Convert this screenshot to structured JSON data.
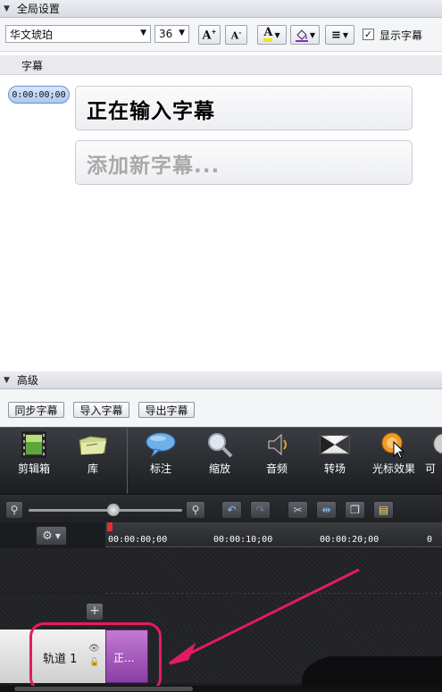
{
  "global_settings": {
    "title": "全局设置"
  },
  "toolbar": {
    "font": "华文琥珀",
    "size": "36",
    "show_captions": "显示字幕",
    "show_captions_checked": true
  },
  "captions_list": {
    "header": "字幕",
    "items": [
      {
        "time": "0:00:00;00",
        "text": "正在输入字幕"
      }
    ],
    "add_placeholder": "添加新字幕..."
  },
  "advanced": {
    "title": "高级",
    "buttons": [
      "同步字幕",
      "导入字幕",
      "导出字幕"
    ]
  },
  "media_tabs": [
    {
      "label": "剪辑箱",
      "icon": "film-strip-icon"
    },
    {
      "label": "库",
      "icon": "folder-icon"
    },
    {
      "label": "标注",
      "icon": "callout-bubble-icon"
    },
    {
      "label": "缩放",
      "icon": "magnifier-icon"
    },
    {
      "label": "音频",
      "icon": "speaker-icon"
    },
    {
      "label": "转场",
      "icon": "transition-icon"
    },
    {
      "label": "光标效果",
      "icon": "cursor-effect-icon"
    },
    {
      "label": "可",
      "icon": "more-icon"
    }
  ],
  "timeline": {
    "zoom_level": 0.55,
    "ticks": [
      "00:00:00;00",
      "00:00:10;00",
      "00:00:20;00",
      "0"
    ],
    "track_name": "轨道 1",
    "clip_text": "正..."
  },
  "colors": {
    "highlight": "#e31b63",
    "clip": "#a857bd",
    "arrow": "#e31b63"
  }
}
